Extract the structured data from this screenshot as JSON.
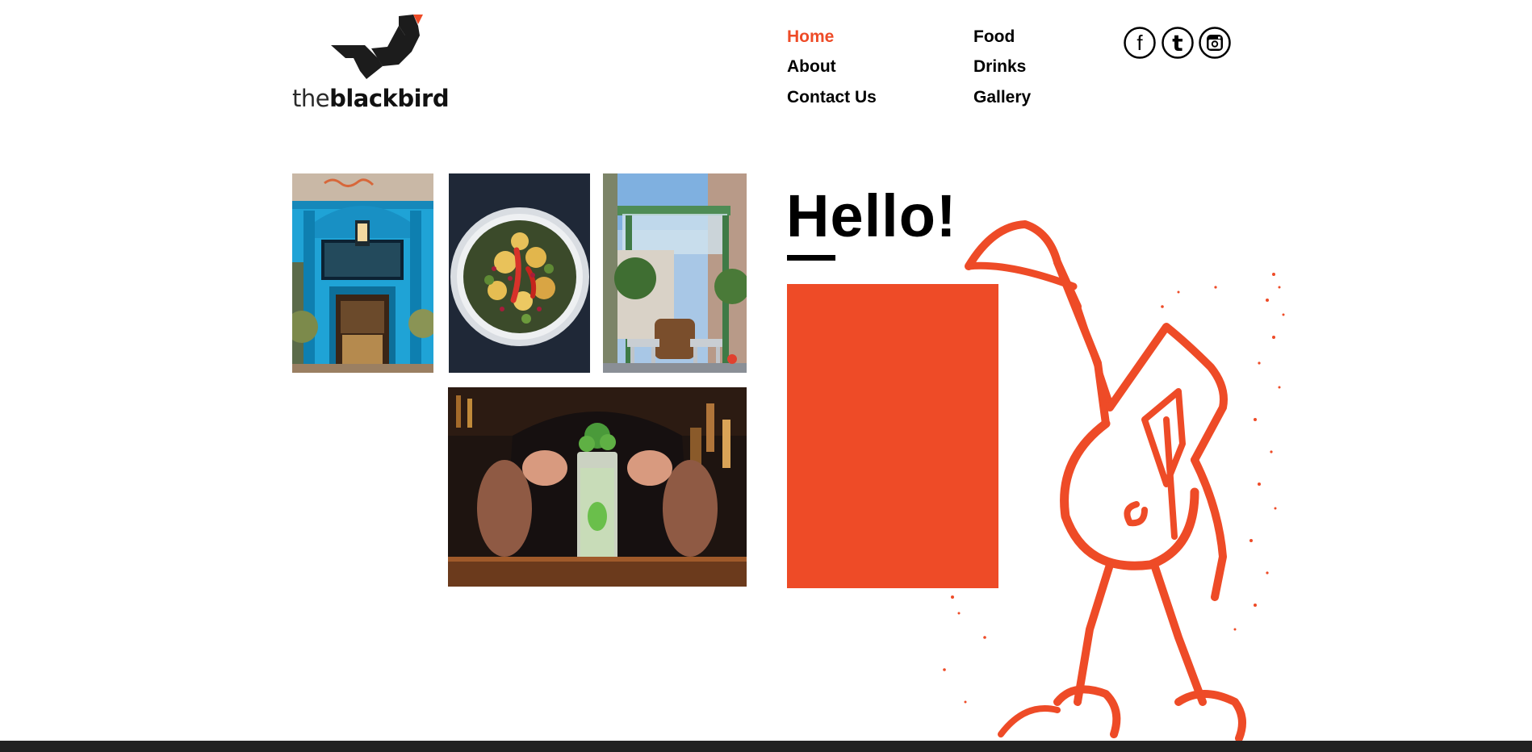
{
  "brand": {
    "logo_prefix": "the",
    "logo_name": "blackbird",
    "logo_icon": "blackbird-logo-icon",
    "accent_color": "#ee4b27",
    "logo_color": "#1c1c1c"
  },
  "nav": {
    "items": [
      {
        "label": "Home",
        "active": true
      },
      {
        "label": "About",
        "active": false
      },
      {
        "label": "Contact Us",
        "active": false
      },
      {
        "label": "Food",
        "active": false
      },
      {
        "label": "Drinks",
        "active": false
      },
      {
        "label": "Gallery",
        "active": false
      }
    ]
  },
  "social": [
    {
      "icon": "facebook-icon",
      "glyph": "f"
    },
    {
      "icon": "twitter-icon",
      "glyph": "t"
    },
    {
      "icon": "instagram-icon",
      "glyph": ""
    }
  ],
  "gallery": {
    "photos": [
      {
        "name": "storefront-photo",
        "subject": "storefront"
      },
      {
        "name": "salad-bowl-photo",
        "subject": "salad-bowl"
      },
      {
        "name": "beer-garden-photo",
        "subject": "beer-garden"
      },
      {
        "name": "cocktail-photo",
        "subject": "cocktail"
      }
    ]
  },
  "main": {
    "heading": "Hello!"
  },
  "colors": {
    "accent": "#ee4b27",
    "text": "#000000",
    "footer": "#222222",
    "background": "#ffffff"
  }
}
